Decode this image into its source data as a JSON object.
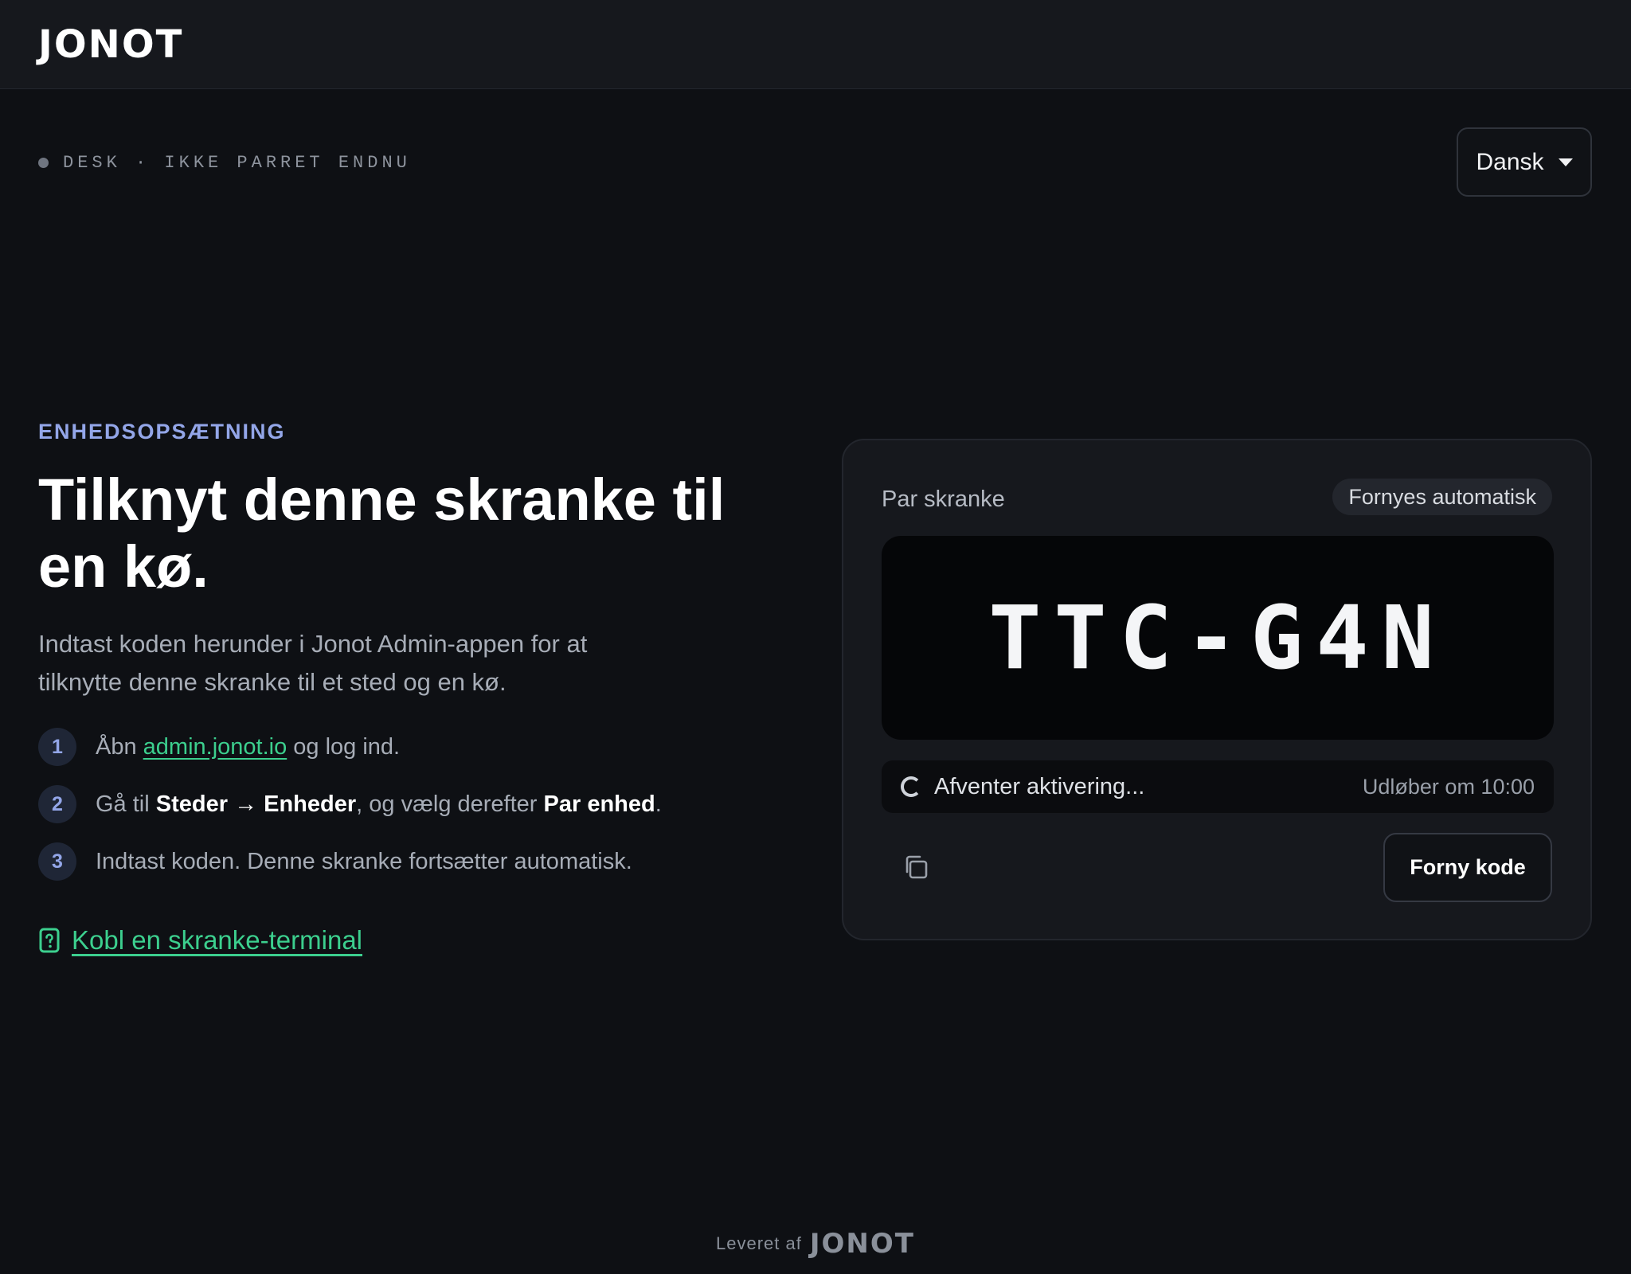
{
  "header": {
    "logo_text": "JONOT"
  },
  "status": {
    "text": "DESK · IKKE PARRET ENDNU"
  },
  "language": {
    "selected": "Dansk"
  },
  "intro": {
    "eyebrow": "ENHEDSOPSÆTNING",
    "headline": "Tilknyt denne skranke til en kø.",
    "lede": "Indtast koden herunder i Jonot Admin-appen for at tilknytte denne skranke til et sted og en kø."
  },
  "steps": [
    {
      "number": "1",
      "prefix": "Åbn ",
      "link": "admin.jonot.io",
      "suffix": " og log ind."
    },
    {
      "number": "2",
      "prefix": "Gå til ",
      "bold1": "Steder → Enheder",
      "middle": ", og vælg derefter ",
      "bold2": "Par enhed",
      "suffix": "."
    },
    {
      "number": "3",
      "text": "Indtast koden. Denne skranke fortsætter automatisk."
    }
  ],
  "help_link": {
    "label": "Kobl en skranke-terminal"
  },
  "pair_card": {
    "title": "Par skranke",
    "badge": "Fornyes automatisk",
    "code": "TTC-G4N",
    "waiting_text": "Afventer aktivering...",
    "expiry_text": "Udløber om 10:00",
    "renew_label": "Forny kode"
  },
  "footer": {
    "prefix": "Leveret af",
    "logo_text": "JONOT"
  },
  "colors": {
    "background": "#0e1014",
    "accent_link": "#3ccf8e",
    "accent_label": "#93a6e8"
  }
}
